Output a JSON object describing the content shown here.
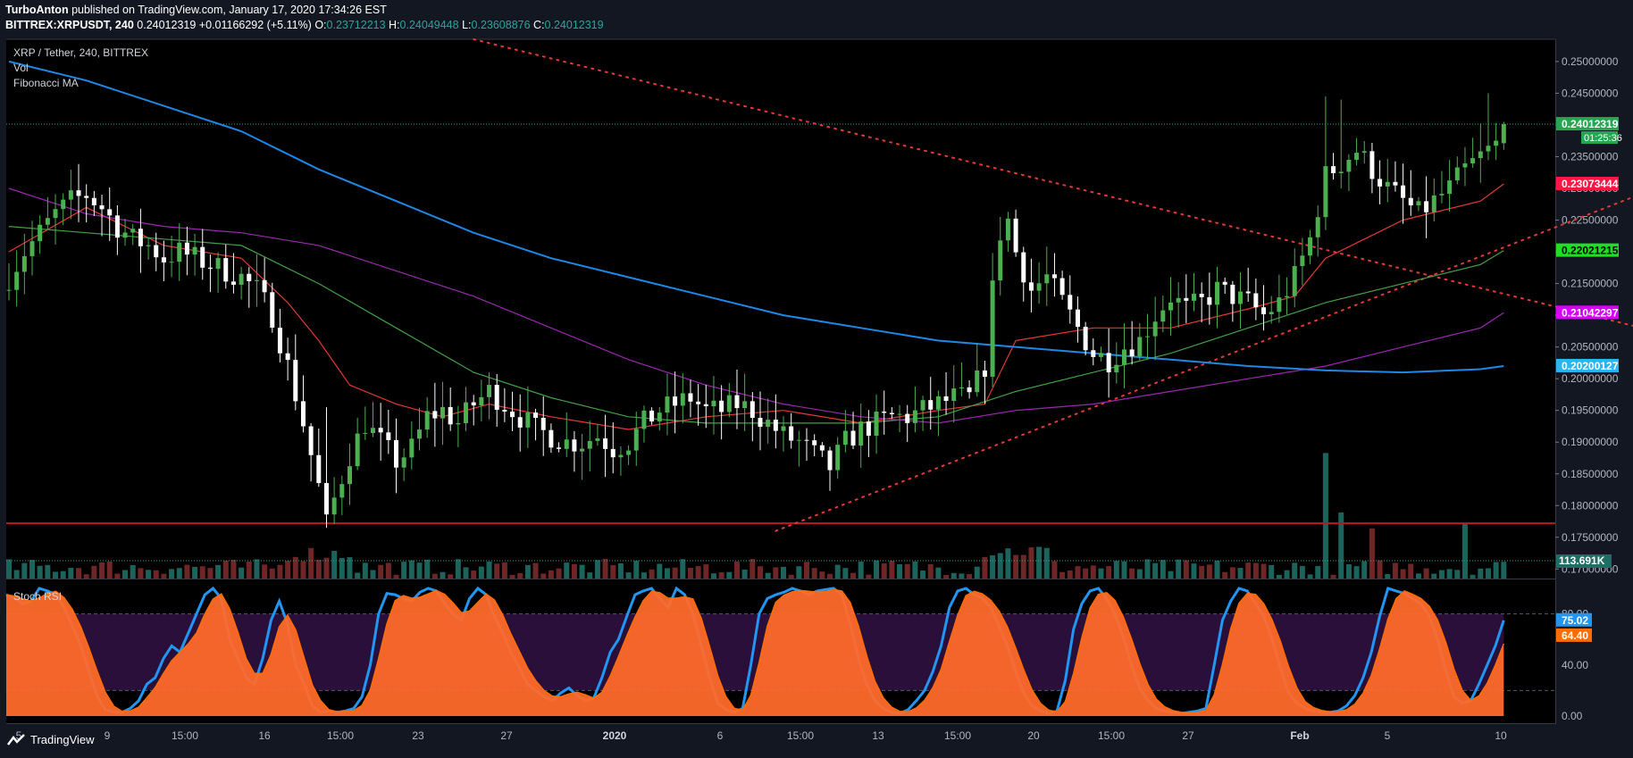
{
  "header": {
    "author": "TurboAnton",
    "published": "published on TradingView.com, January 17, 2020 17:34:26 EST",
    "symbol": "BITTREX:XRPUSDT, 240",
    "last": "0.24012319",
    "change": "+0.01166292 (+5.11%)",
    "o_label": "O:",
    "o": "0.23712213",
    "h_label": "H:",
    "h": "0.24049448",
    "l_label": "L:",
    "l": "0.23608876",
    "c_label": "C:",
    "c": "0.24012319"
  },
  "legend": {
    "series": "XRP / Tether, 240, BITTREX",
    "vol": "Vol",
    "fib": "Fibonacci MA",
    "stoch": "Stoch RSI"
  },
  "footer": {
    "brand": "TradingView"
  },
  "colors": {
    "bg": "#131722",
    "up": "#26a69a",
    "down": "#ef5350",
    "ma_red": "#e53935",
    "ma_green": "#43a047",
    "ma_purple": "#9c27b0",
    "ma_blue": "#1e88e5",
    "stoch_k": "#2196f3",
    "stoch_d": "#ff6d00",
    "support": "#b71c1c"
  },
  "chart_data": [
    {
      "type": "candlestick",
      "title": "XRP / Tether, 240, BITTREX",
      "ylim": [
        0.1685,
        0.2535
      ],
      "y_ticks": [
        "0.25000000",
        "0.24500000",
        "0.24000000",
        "0.23500000",
        "0.23000000",
        "0.22500000",
        "0.22000000",
        "0.21500000",
        "0.21000000",
        "0.20500000",
        "0.20000000",
        "0.19500000",
        "0.19000000",
        "0.18500000",
        "0.18000000",
        "0.17500000",
        "0.17000000"
      ],
      "x_ticks": [
        "5",
        "9",
        "15:00",
        "16",
        "15:00",
        "23",
        "27",
        "2020",
        "6",
        "15:00",
        "13",
        "15:00",
        "20",
        "15:00",
        "27",
        "Feb",
        "5",
        "10"
      ],
      "close_path": [
        [
          0,
          0.216
        ],
        [
          2,
          0.22
        ],
        [
          4,
          0.223
        ],
        [
          6,
          0.226
        ],
        [
          8,
          0.228
        ],
        [
          10,
          0.229
        ],
        [
          12,
          0.227
        ],
        [
          14,
          0.224
        ],
        [
          16,
          0.222
        ],
        [
          18,
          0.221
        ],
        [
          20,
          0.219
        ],
        [
          22,
          0.22
        ],
        [
          24,
          0.219
        ],
        [
          26,
          0.218
        ],
        [
          28,
          0.217
        ],
        [
          30,
          0.216
        ],
        [
          32,
          0.214
        ],
        [
          34,
          0.21
        ],
        [
          36,
          0.202
        ],
        [
          38,
          0.193
        ],
        [
          40,
          0.183
        ],
        [
          41,
          0.177
        ],
        [
          42,
          0.181
        ],
        [
          44,
          0.188
        ],
        [
          46,
          0.193
        ],
        [
          48,
          0.19
        ],
        [
          50,
          0.187
        ],
        [
          52,
          0.189
        ],
        [
          54,
          0.194
        ],
        [
          56,
          0.195
        ],
        [
          58,
          0.193
        ],
        [
          60,
          0.196
        ],
        [
          62,
          0.198
        ],
        [
          64,
          0.196
        ],
        [
          66,
          0.194
        ],
        [
          68,
          0.192
        ],
        [
          70,
          0.191
        ],
        [
          72,
          0.19
        ],
        [
          74,
          0.19
        ],
        [
          76,
          0.191
        ],
        [
          78,
          0.189
        ],
        [
          80,
          0.19
        ],
        [
          82,
          0.193
        ],
        [
          84,
          0.195
        ],
        [
          86,
          0.196
        ],
        [
          88,
          0.197
        ],
        [
          90,
          0.195
        ],
        [
          92,
          0.195
        ],
        [
          94,
          0.196
        ],
        [
          96,
          0.195
        ],
        [
          98,
          0.193
        ],
        [
          100,
          0.191
        ],
        [
          102,
          0.19
        ],
        [
          104,
          0.188
        ],
        [
          106,
          0.186
        ],
        [
          108,
          0.19
        ],
        [
          110,
          0.192
        ],
        [
          112,
          0.193
        ],
        [
          114,
          0.194
        ],
        [
          116,
          0.194
        ],
        [
          118,
          0.195
        ],
        [
          120,
          0.196
        ],
        [
          122,
          0.197
        ],
        [
          124,
          0.197
        ],
        [
          126,
          0.202
        ],
        [
          127,
          0.214
        ],
        [
          128,
          0.223
        ],
        [
          129,
          0.225
        ],
        [
          130,
          0.22
        ],
        [
          132,
          0.214
        ],
        [
          134,
          0.216
        ],
        [
          136,
          0.212
        ],
        [
          138,
          0.208
        ],
        [
          140,
          0.204
        ],
        [
          142,
          0.203
        ],
        [
          144,
          0.205
        ],
        [
          146,
          0.206
        ],
        [
          148,
          0.21
        ],
        [
          150,
          0.213
        ],
        [
          152,
          0.211
        ],
        [
          154,
          0.212
        ],
        [
          156,
          0.214
        ],
        [
          158,
          0.213
        ],
        [
          160,
          0.212
        ],
        [
          162,
          0.21
        ],
        [
          164,
          0.212
        ],
        [
          166,
          0.216
        ],
        [
          168,
          0.222
        ],
        [
          170,
          0.232
        ],
        [
          172,
          0.234
        ],
        [
          174,
          0.236
        ],
        [
          176,
          0.233
        ],
        [
          178,
          0.23
        ],
        [
          180,
          0.228
        ],
        [
          182,
          0.226
        ],
        [
          184,
          0.228
        ],
        [
          186,
          0.23
        ],
        [
          188,
          0.233
        ],
        [
          190,
          0.235
        ],
        [
          192,
          0.237
        ],
        [
          193,
          0.2401
        ]
      ],
      "last_price_label": "0.24012319",
      "countdown": "01:25:36",
      "support_level": 0.1772,
      "trendline_down": {
        "start": [
          60,
          0.2535
        ],
        "end": [
          303,
          0.1802
        ]
      },
      "trendline_up": {
        "start": [
          99,
          0.176
        ],
        "end": [
          262,
          0.2535
        ]
      }
    },
    {
      "type": "line",
      "title": "Fibonacci MA",
      "series": [
        {
          "name": "",
          "label": "0.23073444",
          "values": [
            [
              0,
              0.22
            ],
            [
              10,
              0.227
            ],
            [
              20,
              0.221
            ],
            [
              30,
              0.219
            ],
            [
              36,
              0.212
            ],
            [
              40,
              0.206
            ],
            [
              44,
              0.199
            ],
            [
              50,
              0.196
            ],
            [
              56,
              0.194
            ],
            [
              62,
              0.196
            ],
            [
              70,
              0.194
            ],
            [
              80,
              0.192
            ],
            [
              90,
              0.194
            ],
            [
              100,
              0.195
            ],
            [
              110,
              0.193
            ],
            [
              120,
              0.195
            ],
            [
              126,
              0.196
            ],
            [
              130,
              0.206
            ],
            [
              140,
              0.208
            ],
            [
              150,
              0.208
            ],
            [
              160,
              0.211
            ],
            [
              166,
              0.213
            ],
            [
              170,
              0.219
            ],
            [
              180,
              0.225
            ],
            [
              190,
              0.228
            ],
            [
              193,
              0.2307
            ]
          ]
        },
        {
          "name": "",
          "label": "0.22021215",
          "values": [
            [
              0,
              0.224
            ],
            [
              10,
              0.223
            ],
            [
              20,
              0.222
            ],
            [
              30,
              0.221
            ],
            [
              40,
              0.215
            ],
            [
              50,
              0.208
            ],
            [
              60,
              0.201
            ],
            [
              70,
              0.197
            ],
            [
              80,
              0.194
            ],
            [
              90,
              0.193
            ],
            [
              100,
              0.193
            ],
            [
              110,
              0.193
            ],
            [
              120,
              0.194
            ],
            [
              130,
              0.198
            ],
            [
              140,
              0.201
            ],
            [
              150,
              0.204
            ],
            [
              160,
              0.208
            ],
            [
              170,
              0.212
            ],
            [
              180,
              0.215
            ],
            [
              190,
              0.218
            ],
            [
              193,
              0.2202
            ]
          ]
        },
        {
          "name": "",
          "label": "0.21042297",
          "values": [
            [
              0,
              0.23
            ],
            [
              10,
              0.226
            ],
            [
              20,
              0.224
            ],
            [
              30,
              0.223
            ],
            [
              40,
              0.221
            ],
            [
              50,
              0.217
            ],
            [
              60,
              0.213
            ],
            [
              70,
              0.208
            ],
            [
              80,
              0.203
            ],
            [
              90,
              0.199
            ],
            [
              100,
              0.196
            ],
            [
              110,
              0.194
            ],
            [
              120,
              0.193
            ],
            [
              130,
              0.195
            ],
            [
              140,
              0.196
            ],
            [
              150,
              0.198
            ],
            [
              160,
              0.2
            ],
            [
              170,
              0.202
            ],
            [
              180,
              0.205
            ],
            [
              190,
              0.208
            ],
            [
              193,
              0.2104
            ]
          ]
        },
        {
          "name": "",
          "label": "0.20200127",
          "values": [
            [
              0,
              0.25
            ],
            [
              10,
              0.247
            ],
            [
              20,
              0.243
            ],
            [
              30,
              0.239
            ],
            [
              40,
              0.233
            ],
            [
              50,
              0.228
            ],
            [
              60,
              0.223
            ],
            [
              70,
              0.219
            ],
            [
              80,
              0.216
            ],
            [
              90,
              0.213
            ],
            [
              100,
              0.21
            ],
            [
              110,
              0.208
            ],
            [
              120,
              0.206
            ],
            [
              130,
              0.205
            ],
            [
              140,
              0.204
            ],
            [
              150,
              0.203
            ],
            [
              160,
              0.202
            ],
            [
              170,
              0.2013
            ],
            [
              180,
              0.201
            ],
            [
              190,
              0.2015
            ],
            [
              193,
              0.202
            ]
          ]
        }
      ]
    },
    {
      "type": "bar",
      "title": "Vol",
      "last_label": "113.691K",
      "spikes": [
        [
          170,
          0.95
        ],
        [
          172,
          0.5
        ],
        [
          176,
          0.38
        ],
        [
          188,
          0.42
        ]
      ]
    },
    {
      "type": "area",
      "title": "Stoch RSI",
      "ylim": [
        0,
        100
      ],
      "y_ticks": [
        "80.00",
        "40.00",
        "0.00"
      ],
      "bands": [
        80,
        20
      ],
      "k_label": "75.02",
      "d_label": "64.40",
      "k_values": [
        95,
        92,
        88,
        90,
        100,
        98,
        95,
        85,
        70,
        55,
        35,
        15,
        5,
        3,
        3,
        6,
        12,
        25,
        30,
        45,
        55,
        50,
        65,
        80,
        95,
        100,
        92,
        60,
        45,
        30,
        25,
        45,
        75,
        90,
        72,
        40,
        25,
        8,
        3,
        4,
        3,
        4,
        6,
        15,
        40,
        80,
        96,
        95,
        92,
        90,
        97,
        100,
        98,
        88,
        80,
        75,
        92,
        100,
        95,
        78,
        65,
        50,
        38,
        25,
        20,
        15,
        12,
        18,
        22,
        16,
        12,
        14,
        30,
        50,
        60,
        78,
        95,
        98,
        100,
        92,
        85,
        100,
        95,
        80,
        55,
        30,
        10,
        5,
        3,
        6,
        40,
        80,
        92,
        95,
        97,
        100,
        98,
        95,
        98,
        99,
        100,
        95,
        72,
        45,
        25,
        12,
        6,
        3,
        2,
        5,
        12,
        20,
        35,
        55,
        85,
        98,
        100,
        95,
        92,
        85,
        70,
        55,
        35,
        18,
        8,
        4,
        2,
        4,
        28,
        68,
        88,
        98,
        100,
        92,
        80,
        62,
        40,
        22,
        12,
        6,
        4,
        3,
        2,
        3,
        4,
        6,
        40,
        75,
        90,
        100,
        98,
        88,
        78,
        60,
        38,
        18,
        10,
        6,
        4,
        3,
        3,
        4,
        8,
        16,
        30,
        50,
        78,
        100,
        98,
        96,
        92,
        88,
        78,
        60,
        35,
        15,
        10,
        12,
        25,
        40,
        55,
        75
      ]
    }
  ]
}
